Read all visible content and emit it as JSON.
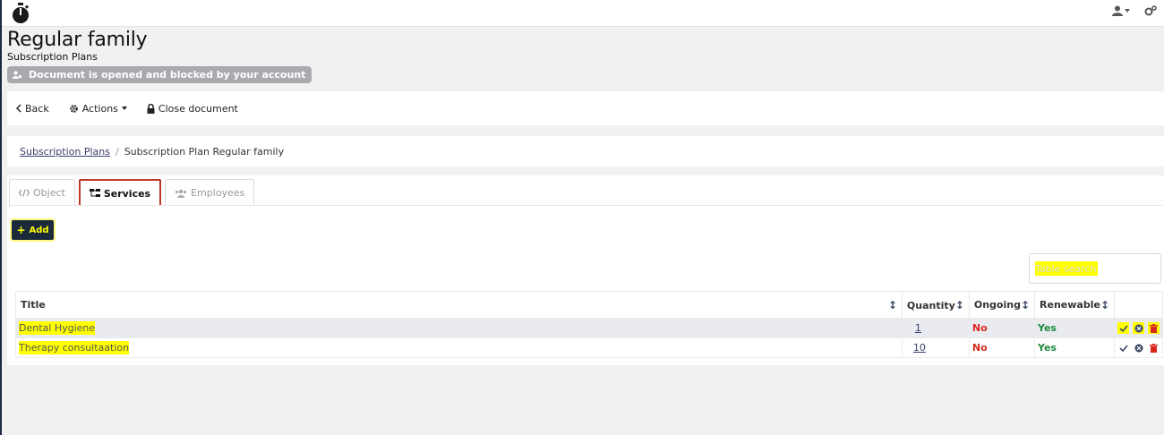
{
  "header": {
    "logo_icon": "stopwatch-icon",
    "user_icon": "user-icon",
    "settings_icon": "gears-icon"
  },
  "page": {
    "title": "Regular family",
    "subtitle": "Subscription Plans",
    "lock_message": "Document is opened and blocked by your account"
  },
  "actions": {
    "back": "Back",
    "actions": "Actions",
    "close": "Close document"
  },
  "breadcrumb": {
    "parent": "Subscription Plans",
    "separator": "/",
    "current": "Subscription Plan Regular family"
  },
  "tabs": [
    {
      "label": "Object",
      "icon": "code-icon"
    },
    {
      "label": "Services",
      "icon": "sitemap-icon"
    },
    {
      "label": "Employees",
      "icon": "users-icon"
    }
  ],
  "add_button": {
    "label": "Add"
  },
  "search": {
    "placeholder": "Table search"
  },
  "table": {
    "headers": {
      "title": "Title",
      "quantity": "Quantity",
      "ongoing": "Ongoing",
      "renewable": "Renewable"
    },
    "rows": [
      {
        "title": "Dental Hygiene",
        "quantity": "1",
        "ongoing": "No",
        "renewable": "Yes"
      },
      {
        "title": "Therapy consultaation",
        "quantity": "10",
        "ongoing": "No",
        "renewable": "Yes"
      }
    ]
  },
  "colors": {
    "accent_dark": "#1b2a3a",
    "active_tab_border": "#c0392b",
    "no": "#d9261c",
    "yes": "#1e8a3c",
    "highlight": "#ffff00"
  }
}
